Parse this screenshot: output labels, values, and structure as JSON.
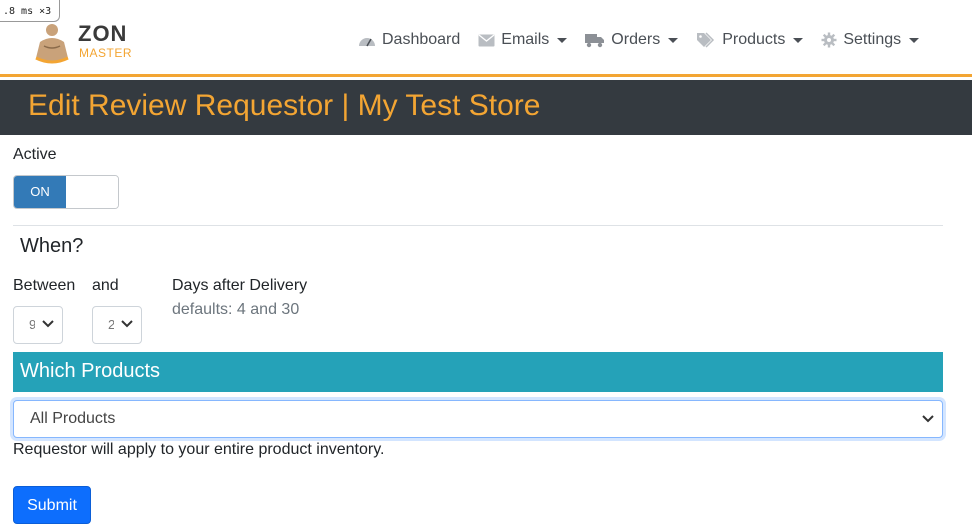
{
  "debug": {
    "text": ".8 ms ×3"
  },
  "brand": {
    "line1": "ZON",
    "line2": "MASTER"
  },
  "nav": {
    "items": [
      {
        "label": "Dashboard",
        "icon": "dashboard-gauge-icon",
        "dropdown": false
      },
      {
        "label": "Emails",
        "icon": "envelope-icon",
        "dropdown": true
      },
      {
        "label": "Orders",
        "icon": "truck-icon",
        "dropdown": true
      },
      {
        "label": "Products",
        "icon": "tags-icon",
        "dropdown": true
      },
      {
        "label": "Settings",
        "icon": "gear-icon",
        "dropdown": true
      }
    ]
  },
  "page": {
    "title": "Edit Review Requestor | My Test Store"
  },
  "active": {
    "label": "Active",
    "toggle_on_text": "ON"
  },
  "when": {
    "heading": "When?",
    "between_label": "Between",
    "and_label": "and",
    "between_value": "9",
    "and_value": "2",
    "days_label": "Days after Delivery",
    "defaults_text": "defaults: 4 and 30"
  },
  "products": {
    "heading": "Which Products",
    "selected": "All Products",
    "help": "Requestor will apply to your entire product inventory."
  },
  "actions": {
    "submit_label": "Submit"
  },
  "colors": {
    "accent_orange": "#f3a533",
    "header_dark": "#343a40",
    "teal": "#25a2b8",
    "primary_blue": "#0d6efd",
    "toggle_blue": "#337ab7"
  }
}
